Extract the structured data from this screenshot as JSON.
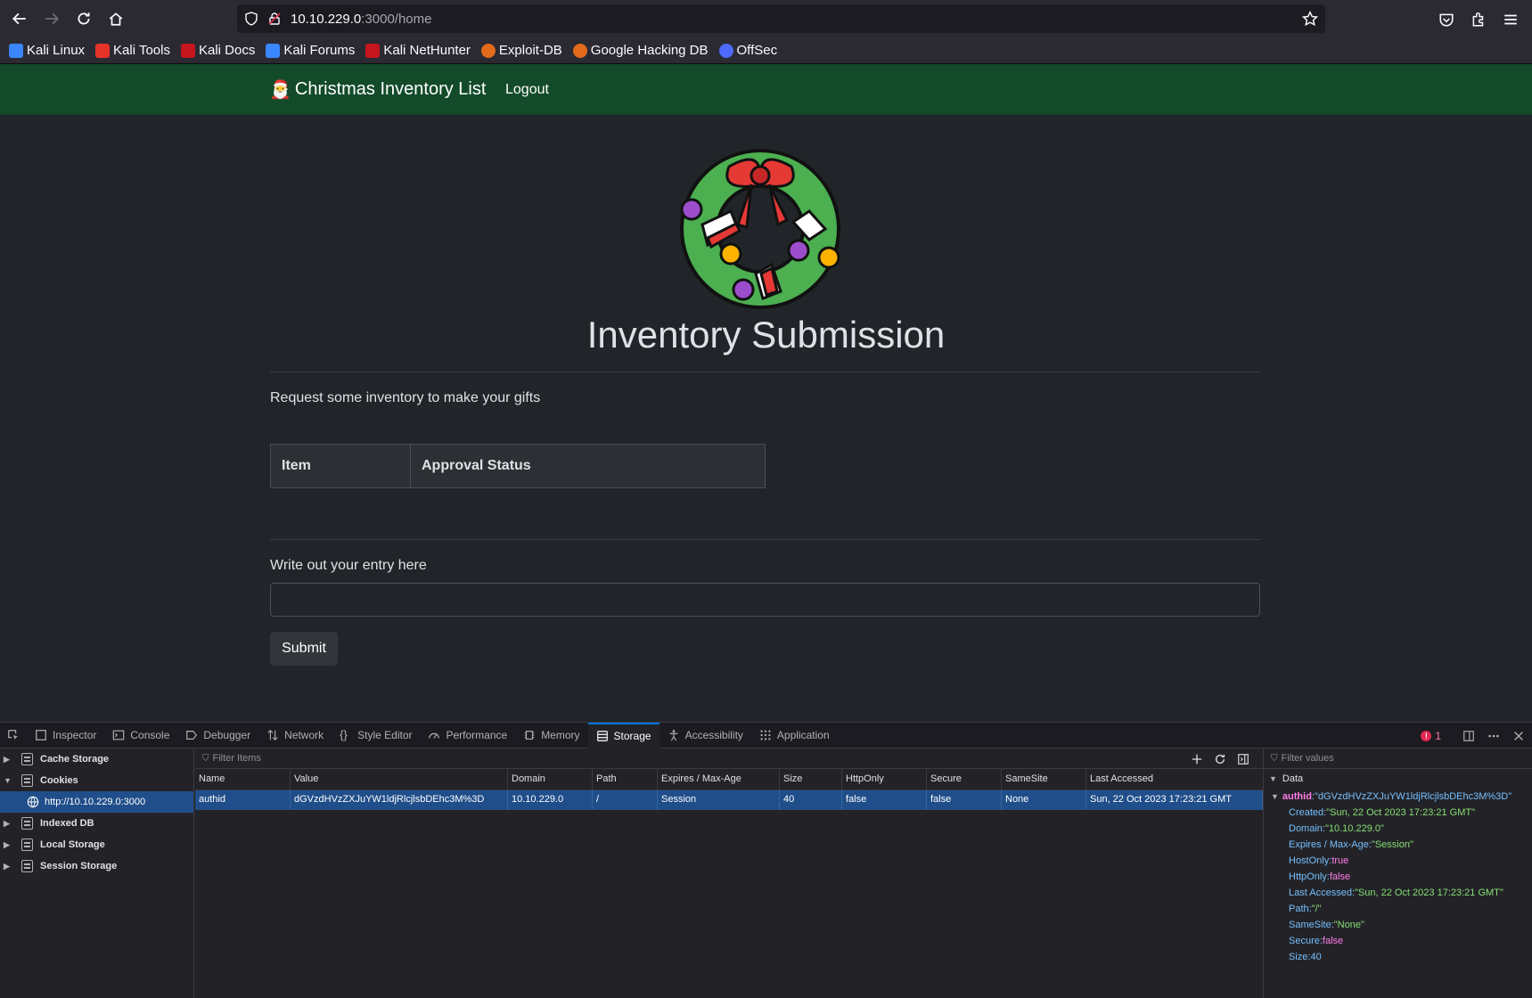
{
  "browser": {
    "url_host": "10.10.229.0",
    "url_path": ":3000/home",
    "bookmarks": [
      {
        "label": "Kali Linux",
        "color": "#3a86ff"
      },
      {
        "label": "Kali Tools",
        "color": "#e6332a"
      },
      {
        "label": "Kali Docs",
        "color": "#c4161c"
      },
      {
        "label": "Kali Forums",
        "color": "#3a86ff"
      },
      {
        "label": "Kali NetHunter",
        "color": "#c4161c"
      },
      {
        "label": "Exploit-DB",
        "color": "#e46a1b"
      },
      {
        "label": "Google Hacking DB",
        "color": "#e46a1b"
      },
      {
        "label": "OffSec",
        "color": "#4d6bfe"
      }
    ]
  },
  "site": {
    "brand_icon": "santa-emoji",
    "brand": "Christmas Inventory List",
    "logout": "Logout",
    "heading": "Inventory Submission",
    "lead": "Request some inventory to make your gifts",
    "table_headers": [
      "Item",
      "Approval Status"
    ],
    "entry_label": "Write out your entry here",
    "entry_value": "",
    "submit": "Submit"
  },
  "devtools": {
    "tabs": [
      "Inspector",
      "Console",
      "Debugger",
      "Network",
      "Style Editor",
      "Performance",
      "Memory",
      "Storage",
      "Accessibility",
      "Application"
    ],
    "active_tab": "Storage",
    "error_count": "1",
    "tree": {
      "cache_storage": "Cache Storage",
      "cookies": "Cookies",
      "cookie_origin": "http://10.10.229.0:3000",
      "indexed_db": "Indexed DB",
      "local_storage": "Local Storage",
      "session_storage": "Session Storage"
    },
    "filter_items_placeholder": "Filter Items",
    "filter_values_placeholder": "Filter values",
    "columns": [
      "Name",
      "Value",
      "Domain",
      "Path",
      "Expires / Max-Age",
      "Size",
      "HttpOnly",
      "Secure",
      "SameSite",
      "Last Accessed"
    ],
    "row": [
      "authid",
      "dGVzdHVzZXJuYW1ldjRlcjlsbDEhc3M%3D",
      "10.10.229.0",
      "/",
      "Session",
      "40",
      "false",
      "false",
      "None",
      "Sun, 22 Oct 2023 17:23:21 GMT"
    ],
    "sidebar": {
      "header": "Data",
      "root_key": "authid",
      "root_value": "\"dGVzdHVzZXJuYW1ldjRlcjlsbDEhc3M%3D\"",
      "fields": [
        {
          "key": "Created",
          "value": "\"Sun, 22 Oct 2023 17:23:21 GMT\"",
          "kind": "str"
        },
        {
          "key": "Domain",
          "value": "\"10.10.229.0\"",
          "kind": "str"
        },
        {
          "key": "Expires / Max-Age",
          "value": "\"Session\"",
          "kind": "str"
        },
        {
          "key": "HostOnly",
          "value": "true",
          "kind": "bool"
        },
        {
          "key": "HttpOnly",
          "value": "false",
          "kind": "bool"
        },
        {
          "key": "Last Accessed",
          "value": "\"Sun, 22 Oct 2023 17:23:21 GMT\"",
          "kind": "str"
        },
        {
          "key": "Path",
          "value": "\"/\"",
          "kind": "str"
        },
        {
          "key": "SameSite",
          "value": "\"None\"",
          "kind": "str"
        },
        {
          "key": "Secure",
          "value": "false",
          "kind": "bool"
        },
        {
          "key": "Size",
          "value": "40",
          "kind": "num"
        }
      ]
    }
  }
}
